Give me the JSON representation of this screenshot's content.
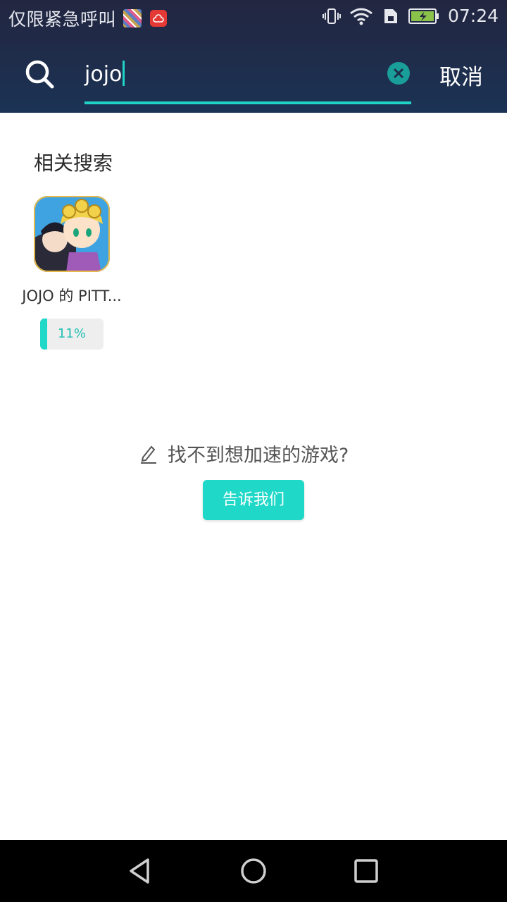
{
  "status_bar": {
    "carrier_text": "仅限紧急呼叫",
    "time": "07:24",
    "icons": [
      "notification-thumbnail-icon",
      "cloud-upload-icon",
      "vibrate-icon",
      "wifi-icon",
      "sim-icon",
      "battery-charging-icon"
    ]
  },
  "search": {
    "value": "jojo",
    "cancel_label": "取消"
  },
  "related": {
    "title": "相关搜索",
    "games": [
      {
        "name": "JOJO 的 PITT...",
        "progress_label": "11%",
        "progress": 0.11
      }
    ]
  },
  "feedback": {
    "prompt": "找不到想加速的游戏?",
    "button_label": "告诉我们"
  },
  "colors": {
    "accent": "#1fd8c8",
    "header_bg": "#1f2c4a"
  }
}
